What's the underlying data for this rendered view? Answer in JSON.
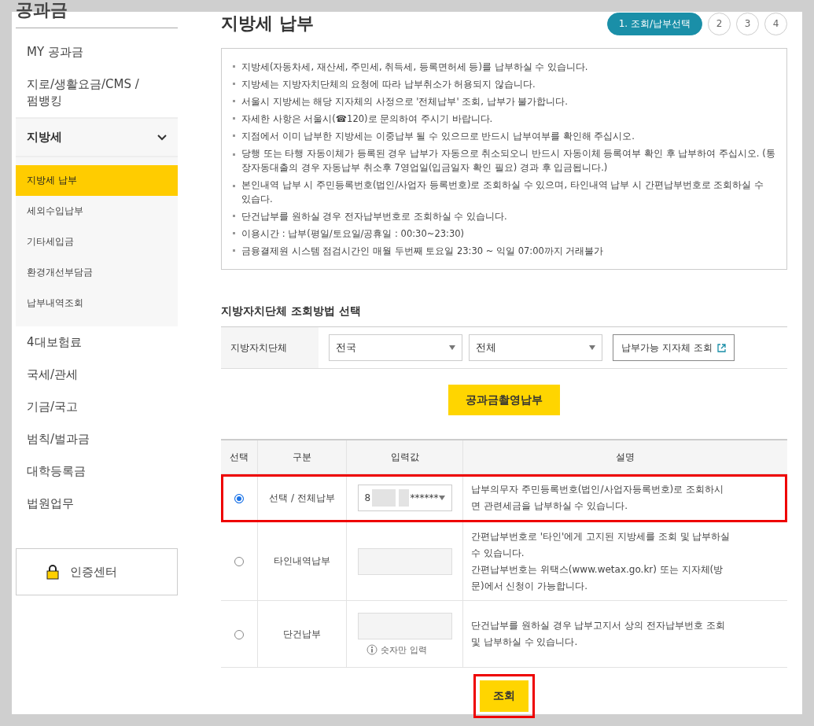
{
  "sidebar": {
    "title": "공과금",
    "items": [
      {
        "label": "MY 공과금",
        "expanded": false
      },
      {
        "label": "지로/생활요금/CMS /펌뱅킹",
        "expanded": false
      },
      {
        "label": "지방세",
        "expanded": true,
        "children": [
          {
            "label": "지방세 납부",
            "selected": true
          },
          {
            "label": "세외수입납부",
            "selected": false
          },
          {
            "label": "기타세입금",
            "selected": false
          },
          {
            "label": "환경개선부담금",
            "selected": false
          },
          {
            "label": "납부내역조회",
            "selected": false
          }
        ]
      },
      {
        "label": "4대보험료",
        "expanded": false
      },
      {
        "label": "국세/관세",
        "expanded": false
      },
      {
        "label": "기금/국고",
        "expanded": false
      },
      {
        "label": "범칙/벌과금",
        "expanded": false
      },
      {
        "label": "대학등록금",
        "expanded": false
      },
      {
        "label": "법원업무",
        "expanded": false
      }
    ],
    "auth_button": "인증센터"
  },
  "page_title": "지방세 납부",
  "steps": [
    {
      "label": "1. 조회/납부선택",
      "selected": true
    },
    {
      "label": "2",
      "selected": false
    },
    {
      "label": "3",
      "selected": false
    },
    {
      "label": "4",
      "selected": false
    }
  ],
  "notices": [
    "지방세(자동차세, 재산세, 주민세, 취득세, 등록면허세 등)를 납부하실 수 있습니다.",
    "지방세는 지방자치단체의 요청에 따라 납부취소가 허용되지 않습니다.",
    "서울시 지방세는 해당 지자체의 사정으로 '전체납부' 조회, 납부가 불가합니다.",
    "자세한 사항은 서울시(☎120)로 문의하여 주시기 바랍니다.",
    "지점에서 이미 납부한 지방세는 이중납부 될 수 있으므로 반드시 납부여부를 확인해 주십시오.",
    "당행 또는 타행 자동이체가 등록된 경우 납부가 자동으로 취소되오니 반드시 자동이체 등록여부 확인 후 납부하여 주십시오. (통장자동대출의 경우 자동납부 취소후 7영업일(입금일자 확인 필요) 경과 후 입금됩니다.)",
    "본인내역 납부 시 주민등록번호(법인/사업자 등록번호)로 조회하실 수 있으며, 타인내역 납부 시 간편납부번호로 조회하실 수 있습다.",
    "단건납부를 원하실 경우 전자납부번호로 조회하실 수 있습니다.",
    "이용시간 : 납부(평일/토요일/공휴일 : 00:30~23:30)",
    "금융결제원 시스템 점검시간인 매월 두번째 토요일 23:30 ~ 익일 07:00까지 거래불가"
  ],
  "region_section": {
    "title": "지방자치단체 조회방법 선택",
    "label": "지방자치단체",
    "select_1": "전국",
    "select_2": "전체",
    "lookup_button": "납부가능 지자체 조회"
  },
  "photo_pay_button": "공과금촬영납부",
  "table": {
    "columns": [
      "선택",
      "구분",
      "입력값",
      "설명"
    ],
    "rows": [
      {
        "selected": true,
        "highlighted": true,
        "type": "선택 / 전체납부",
        "input": {
          "kind": "select",
          "value_start": "8",
          "value_end": "******"
        },
        "description": "납부의무자 주민등록번호(법인/사업자등록번호)로 조회하시면 관련세금을 납부하실 수 있습니다."
      },
      {
        "selected": false,
        "highlighted": false,
        "type": "타인내역납부",
        "input": {
          "kind": "text"
        },
        "description": "간편납부번호로 '타인'에게 고지된 지방세를 조회 및 납부하실 수 있습니다.\n간편납부번호는 위택스(www.wetax.go.kr) 또는 지자체(방문)에서 신청이 가능합니다."
      },
      {
        "selected": false,
        "highlighted": false,
        "type": "단건납부",
        "input": {
          "kind": "text",
          "hint": "숫자만 입력"
        },
        "description": "단건납부를 원하실 경우 납부고지서 상의 전자납부번호 조회 및 납부하실 수 있습니다."
      }
    ]
  },
  "search_button": {
    "label": "조회",
    "highlighted": true
  }
}
